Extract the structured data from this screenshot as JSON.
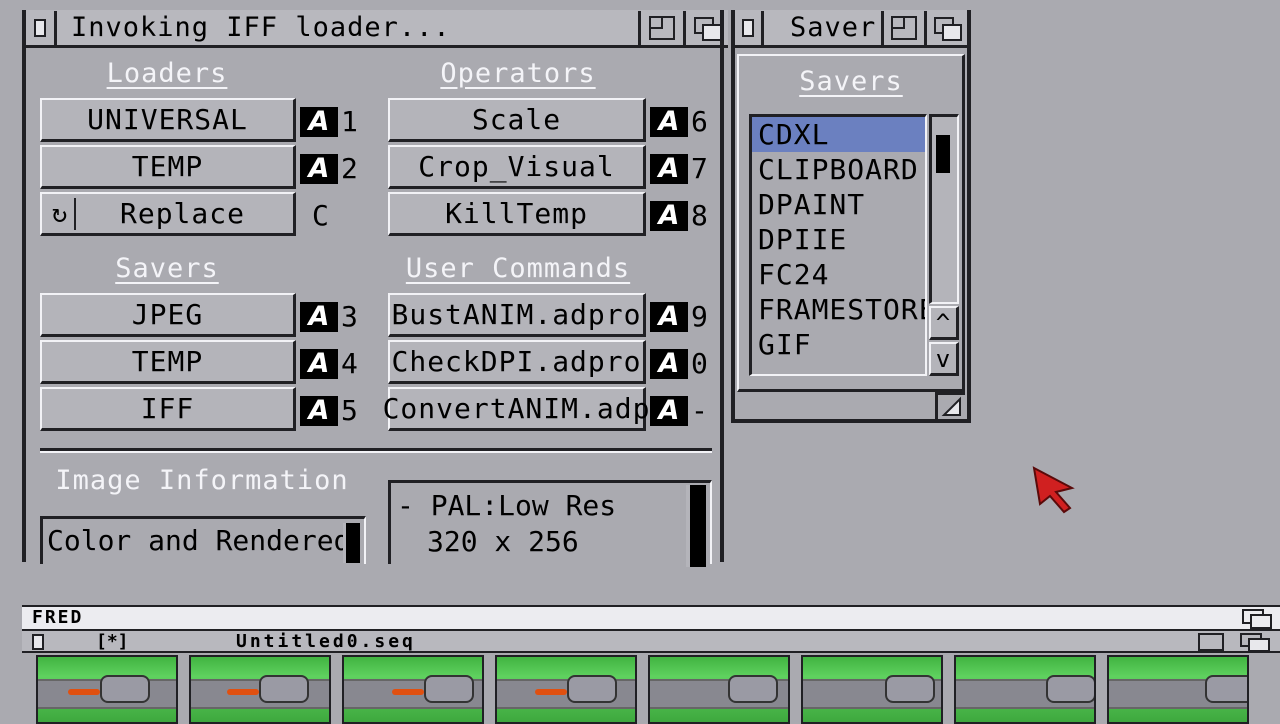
{
  "main_window": {
    "title": "Invoking IFF loader...",
    "loaders_label": "Loaders",
    "operators_label": "Operators",
    "savers_label": "Savers",
    "user_commands_label": "User Commands",
    "loaders": [
      {
        "label": "UNIVERSAL",
        "key": "1"
      },
      {
        "label": "TEMP",
        "key": "2"
      }
    ],
    "replace_label": "Replace",
    "replace_key": "C",
    "operators": [
      {
        "label": "Scale",
        "key": "6"
      },
      {
        "label": "Crop_Visual",
        "key": "7"
      },
      {
        "label": "KillTemp",
        "key": "8"
      }
    ],
    "savers": [
      {
        "label": "JPEG",
        "key": "3"
      },
      {
        "label": "TEMP",
        "key": "4"
      },
      {
        "label": "IFF",
        "key": "5"
      }
    ],
    "user_commands": [
      {
        "label": "BustANIM.adpro",
        "key": "9"
      },
      {
        "label": "CheckDPI.adpro",
        "key": "0"
      },
      {
        "label": "ConvertANIM.adp",
        "key": "-"
      }
    ],
    "key_glyph": "A",
    "image_info_label": "Image Information",
    "image_info_value": "Color and Rendered",
    "display_mode_line1": "- PAL:Low Res",
    "display_mode_line2": "320 x 256"
  },
  "saver_window": {
    "title": "Saver",
    "list_label": "Savers",
    "items": [
      "CDXL",
      "CLIPBOARD",
      "DPAINT",
      "DPIIE",
      "FC24",
      "FRAMESTORE",
      "GIF"
    ],
    "selected_index": 0,
    "scroll_up": "^",
    "scroll_down": "v"
  },
  "fred_window": {
    "screen_title": "FRED",
    "window_marker": "[*]",
    "file_name": "Untitled0.seq",
    "frame_count": 8
  },
  "colors": {
    "background": "#aaaab0",
    "selection": "#6b80c0",
    "pointer": "#d02020",
    "thumbnail_green": "#41b441"
  }
}
